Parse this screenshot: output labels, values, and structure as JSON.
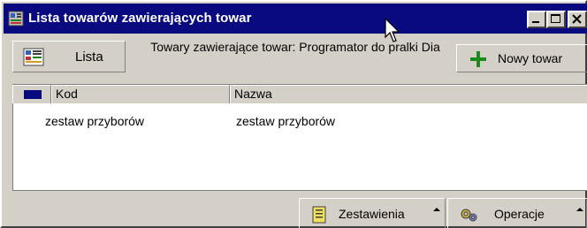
{
  "window": {
    "title": "Lista towarów zawierających towar",
    "buttons": [
      "minimize",
      "maximize",
      "close"
    ],
    "title_bar_color": "#0a0a80",
    "face_color": "#d4d0c8"
  },
  "toolbar": {
    "list_button_label": "Lista",
    "caption": "Towary zawierające towar: Programator do pralki Dia",
    "new_button_label": "Nowy towar",
    "new_button_icon": "plus-icon",
    "accent_green": "#1a8a1a"
  },
  "grid": {
    "columns": [
      "Kod",
      "Nazwa"
    ],
    "rows": [
      {
        "kod": "zestaw przyborów",
        "nazwa": "zestaw przyborów"
      }
    ]
  },
  "footer": {
    "reports_label": "Zestawienia",
    "reports_icon": "report-icon",
    "operations_label": "Operacje",
    "operations_icon": "gears-icon"
  }
}
